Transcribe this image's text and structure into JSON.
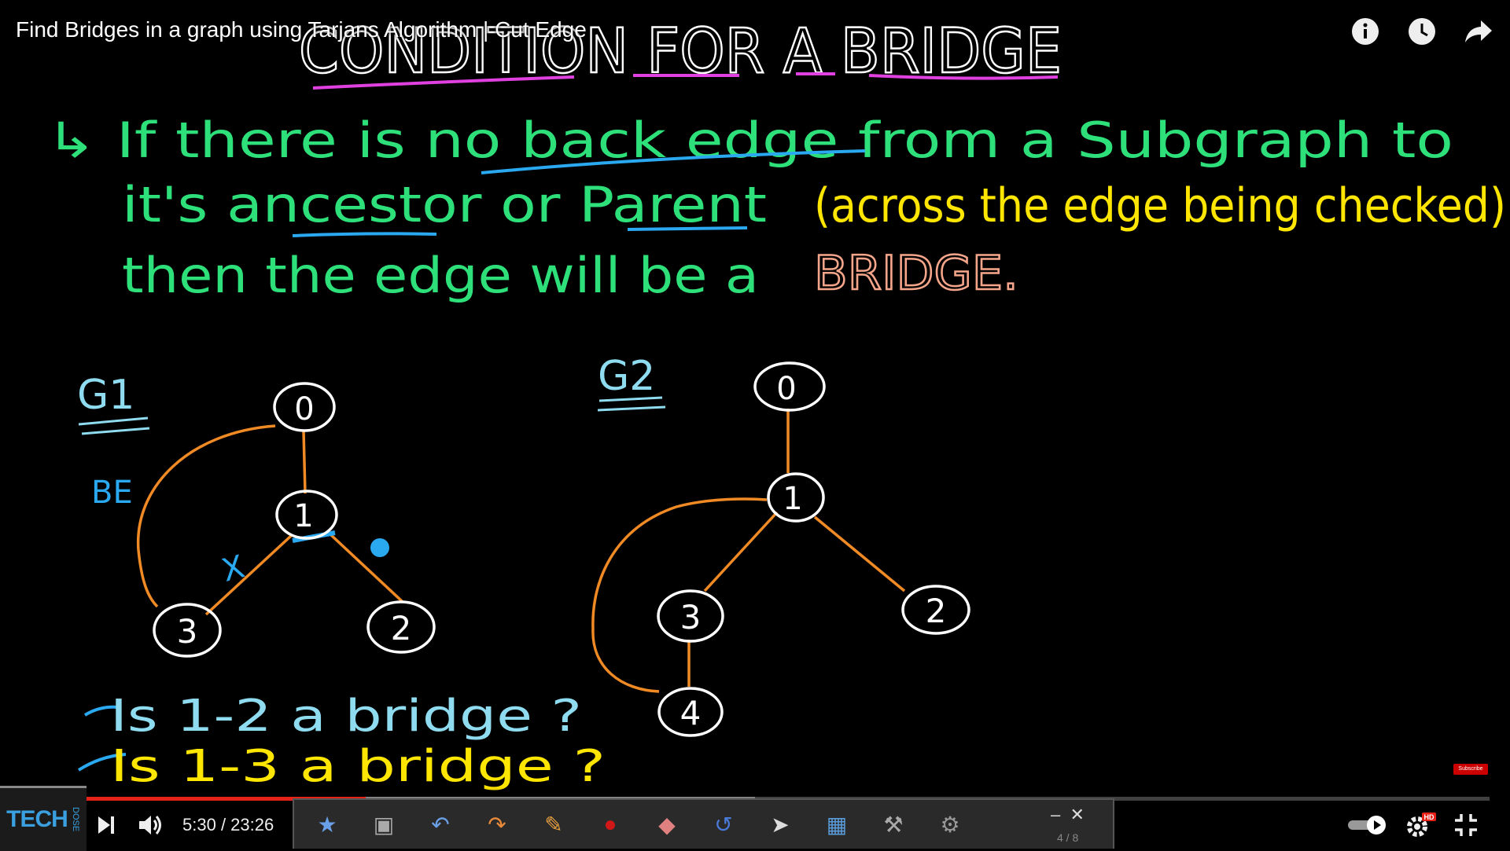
{
  "video": {
    "title": "Find Bridges in a graph using Tarjans Algorithm | Cut Edge",
    "time_current": "5:30",
    "time_separator": " / ",
    "time_total": "23:26",
    "progress_fraction": 0.235
  },
  "board": {
    "heading": "CONDITION FOR A BRIDGE",
    "line1": "↳ If there is no back edge from a Subgraph to",
    "line2a": "it's ancestor or Parent",
    "line2b": "(across the edge being checked)",
    "line3a": "then the edge will be a",
    "line3b": "BRIDGE.",
    "g1_label": "G1",
    "g2_label": "G2",
    "be_label": "BE",
    "x_mark": "X",
    "q1": "Is 1-2 a bridge ?",
    "q2": "Is 1-3 a bridge ?",
    "g1_nodes": [
      "0",
      "1",
      "3",
      "2"
    ],
    "g2_nodes": [
      "0",
      "1",
      "3",
      "2",
      "4"
    ]
  },
  "branding": {
    "logo_main": "TECH",
    "logo_side": "DOSE",
    "subscribe": "Subscribe"
  },
  "toolbar": {
    "page_indicator": "4 / 8"
  },
  "colors": {
    "heading": "#ffffff",
    "green": "#2ee07a",
    "yellow": "#ffe600",
    "salmon": "#f4a58a",
    "underline_magenta": "#e040e0",
    "underline_blue": "#2aa8f0",
    "edge_orange": "#f08a24",
    "cyan": "#8fdcf0",
    "progress": "#e62117"
  },
  "icons": {
    "info": "info-icon",
    "watch_later": "clock-icon",
    "share": "share-icon",
    "next": "next-icon",
    "volume": "volume-icon",
    "autoplay": "toggle-icon",
    "settings": "settings-icon",
    "fullscreen": "exit-fullscreen-icon"
  }
}
